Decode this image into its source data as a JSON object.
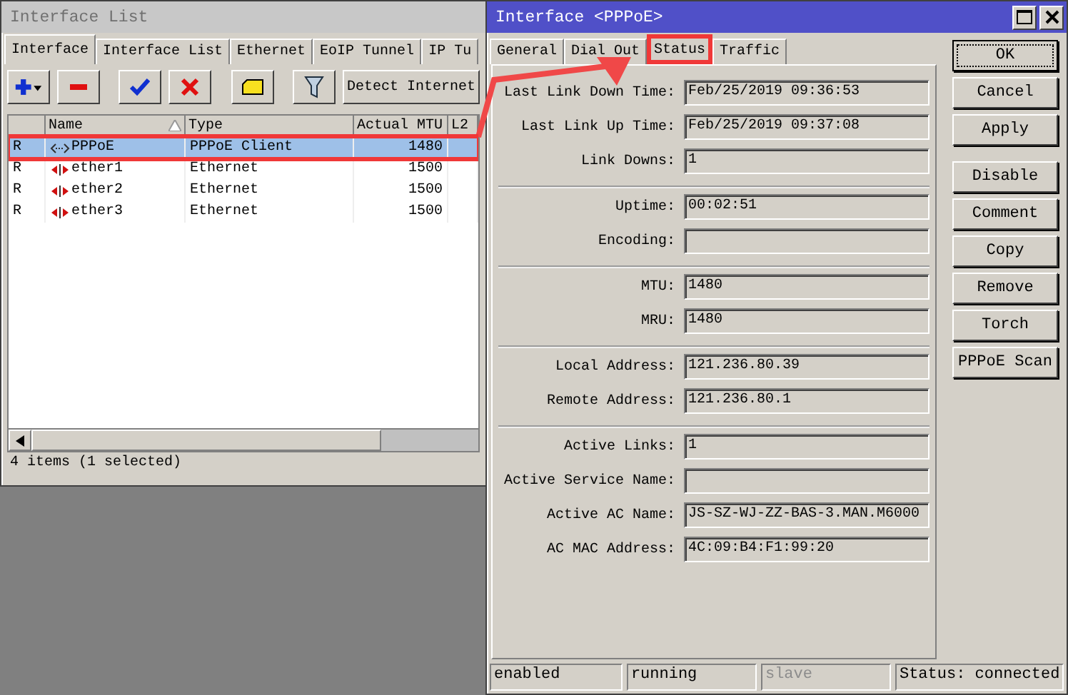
{
  "interface_list_window": {
    "title": "Interface List",
    "active": false,
    "tabs": [
      {
        "label": "Interface",
        "selected": true
      },
      {
        "label": "Interface List",
        "selected": false
      },
      {
        "label": "Ethernet",
        "selected": false
      },
      {
        "label": "EoIP Tunnel",
        "selected": false
      },
      {
        "label": "IP Tu",
        "selected": false
      }
    ],
    "toolbar": {
      "detect_button": "Detect Internet"
    },
    "table": {
      "columns": [
        "",
        "Name",
        "Type",
        "Actual MTU",
        "L2"
      ],
      "rows": [
        {
          "flag": "R",
          "name": "PPPoE",
          "type": "PPPoE Client",
          "mtu": "1480",
          "kind": "pppoe",
          "selected": true,
          "highlighted": true
        },
        {
          "flag": "R",
          "name": "ether1",
          "type": "Ethernet",
          "mtu": "1500",
          "kind": "ethernet",
          "selected": false
        },
        {
          "flag": "R",
          "name": "ether2",
          "type": "Ethernet",
          "mtu": "1500",
          "kind": "ethernet",
          "selected": false
        },
        {
          "flag": "R",
          "name": "ether3",
          "type": "Ethernet",
          "mtu": "1500",
          "kind": "ethernet",
          "selected": false
        }
      ]
    },
    "status_bar": "4 items (1 selected)"
  },
  "interface_window": {
    "title": "Interface <PPPoE>",
    "active": true,
    "tabs": [
      {
        "label": "General",
        "selected": false
      },
      {
        "label": "Dial Out",
        "selected": false
      },
      {
        "label": "Status",
        "selected": true,
        "highlighted": true
      },
      {
        "label": "Traffic",
        "selected": false
      }
    ],
    "field_groups": [
      [
        {
          "label": "Last Link Down Time:",
          "value": "Feb/25/2019 09:36:53"
        },
        {
          "label": "Last Link Up Time:",
          "value": "Feb/25/2019 09:37:08"
        },
        {
          "label": "Link Downs:",
          "value": "1"
        }
      ],
      [
        {
          "label": "Uptime:",
          "value": "00:02:51"
        },
        {
          "label": "Encoding:"
        }
      ],
      [
        {
          "label": "MTU:",
          "value": "1480"
        },
        {
          "label": "MRU:",
          "value": "1480"
        }
      ],
      [
        {
          "label": "Local Address:",
          "value": "121.236.80.39"
        },
        {
          "label": "Remote Address:",
          "value": "121.236.80.1"
        }
      ],
      [
        {
          "label": "Active Links:",
          "value": "1"
        },
        {
          "label": "Active Service Name:"
        },
        {
          "label": "Active AC Name:",
          "value": "JS-SZ-WJ-ZZ-BAS-3.MAN.M6000"
        },
        {
          "label": "AC MAC Address:",
          "value": "4C:09:B4:F1:99:20"
        }
      ]
    ],
    "button_groups": [
      [
        {
          "label": "OK",
          "focused": true
        },
        {
          "label": "Cancel",
          "focused": false
        },
        {
          "label": "Apply",
          "focused": false
        }
      ],
      [
        {
          "label": "Disable",
          "focused": false
        },
        {
          "label": "Comment",
          "focused": false
        },
        {
          "label": "Copy",
          "focused": false
        },
        {
          "label": "Remove",
          "focused": false
        },
        {
          "label": "Torch",
          "focused": false
        },
        {
          "label": "PPPoE Scan",
          "focused": false
        }
      ]
    ],
    "status_bar": [
      {
        "text": "enabled",
        "disabled": false
      },
      {
        "text": "running",
        "disabled": false
      },
      {
        "text": "slave",
        "disabled": true
      },
      {
        "text": "Status: connected",
        "disabled": false
      }
    ]
  }
}
